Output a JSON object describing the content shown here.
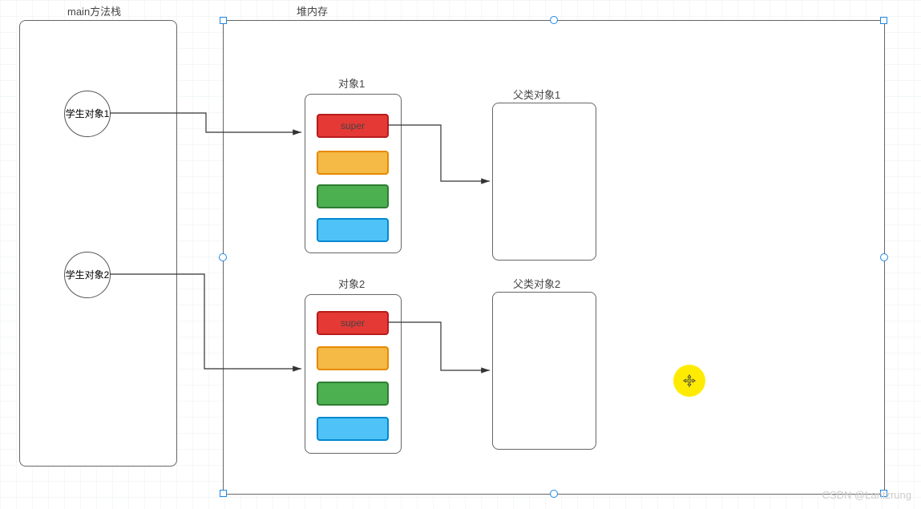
{
  "titles": {
    "stack": "main方法栈",
    "heap": "堆内存"
  },
  "stack_refs": {
    "ref1": "学生对象1",
    "ref2": "学生对象2"
  },
  "objects": {
    "obj1_label": "对象1",
    "obj2_label": "对象2",
    "super_label": "super"
  },
  "parents": {
    "p1_label": "父类对象1",
    "p2_label": "父类对象2"
  },
  "watermark": "CSDN @Lantzrung"
}
